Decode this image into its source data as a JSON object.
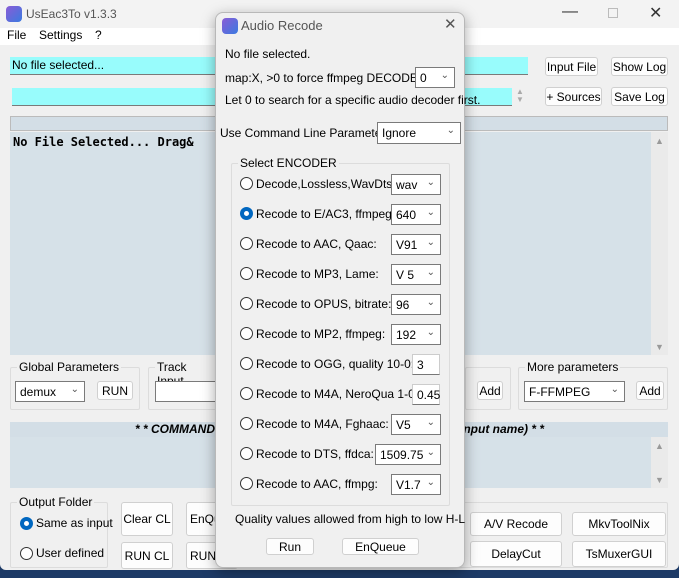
{
  "main": {
    "title": "UsEac3To v1.3.3",
    "menu": [
      "File",
      "Settings",
      "?"
    ],
    "input_value": "No file selected...",
    "input_file": "Input File",
    "show_log": "Show Log",
    "sources": "+ Sources",
    "save_log": "Save Log",
    "log_text": "No File Selected... Drag&",
    "global_params": {
      "label": "Global Parameters",
      "value": "demux",
      "run": "RUN"
    },
    "track_input": {
      "label": "Track Input",
      "value": ""
    },
    "add": "Add",
    "more_params": {
      "label": "More parameters",
      "value": "F-FFMPEG",
      "add": "Add"
    },
    "command_header_left": "* * COMMAND",
    "command_header_right": "input name) * *",
    "output_folder": {
      "label": "Output Folder",
      "options": [
        "Same as input",
        "User defined"
      ],
      "selected": 0
    },
    "clear_cl": "Clear CL",
    "run_cl": "RUN CL",
    "enqueue": "EnQu",
    "run_q": "RUN (",
    "av_recode": "A/V Recode",
    "mkvtoolnix": "MkvToolNix",
    "delaycut": "DelayCut",
    "tsmuxer": "TsMuxerGUI"
  },
  "dialog": {
    "title": "Audio Recode",
    "status": "No file selected.",
    "decoder_label": "map:X, >0 to force ffmpeg DECODER:",
    "decoder_value": "0",
    "decoder_hint": "Let 0 to search for a specific audio decoder first.",
    "cmd_label": "Use Command Line Parameters",
    "cmd_value": "Ignore",
    "encoder_group": "Select ENCODER",
    "encoders": [
      {
        "label": "Decode,Lossless,WavDts",
        "value": "wav"
      },
      {
        "label": "Recode to E/AC3, ffmpeg:",
        "value": "640"
      },
      {
        "label": "Recode to AAC, Qaac:",
        "value": "V91"
      },
      {
        "label": "Recode to MP3, Lame:",
        "value": "V 5"
      },
      {
        "label": "Recode to OPUS, bitrate:",
        "value": "96"
      },
      {
        "label": "Recode to MP2, ffmpeg:",
        "value": "192"
      },
      {
        "label": "Recode to OGG, quality 10-0:",
        "value": "3"
      },
      {
        "label": "Recode to M4A, NeroQua 1-0:",
        "value": "0.45"
      },
      {
        "label": "Recode to M4A, Fghaac:",
        "value": "V5"
      },
      {
        "label": "Recode to DTS, ffdca:",
        "value": "1509.75"
      },
      {
        "label": "Recode to AAC, ffmpg:",
        "value": "V1.7"
      }
    ],
    "selected_encoder": 1,
    "quality_note": "Quality values allowed from high to low H-L",
    "run": "Run",
    "enqueue": "EnQueue"
  }
}
